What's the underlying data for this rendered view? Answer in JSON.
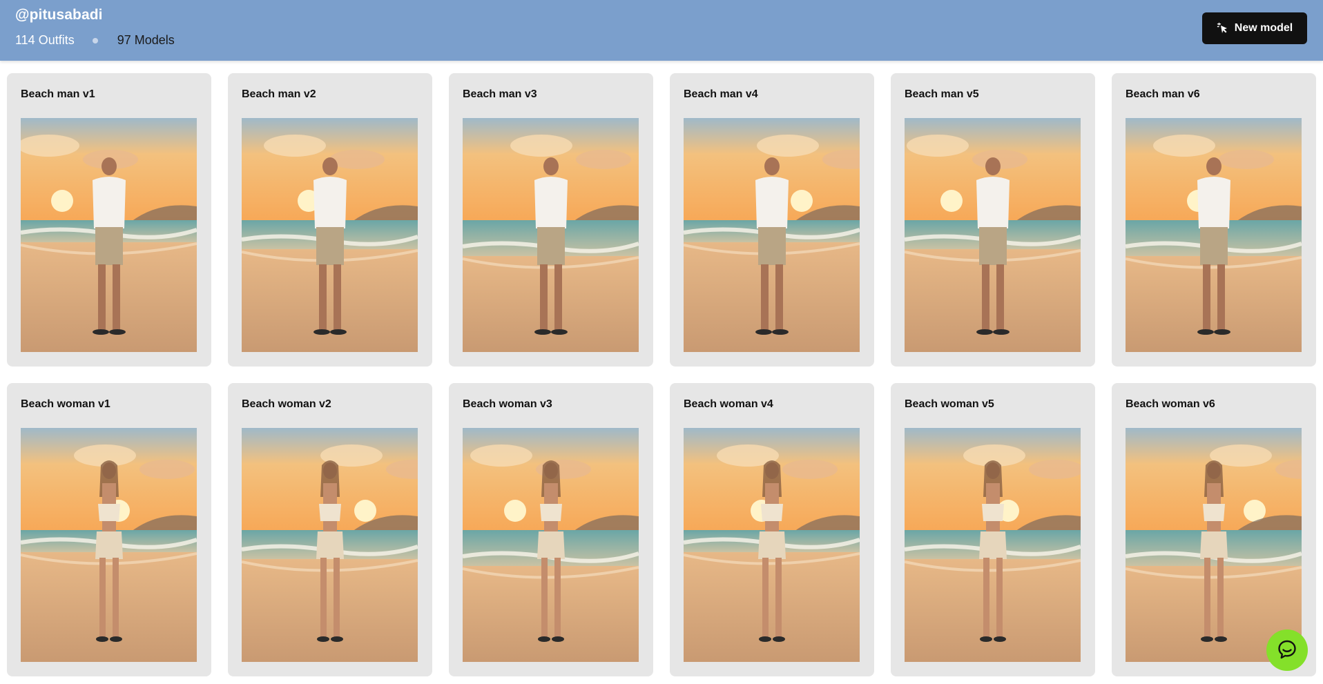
{
  "header": {
    "username": "@pitusabadi",
    "outfits_label": "114 Outfits",
    "models_label": "97 Models",
    "new_model_label": "New model"
  },
  "cards": [
    {
      "title": "Beach man v1",
      "gender": "man"
    },
    {
      "title": "Beach man v2",
      "gender": "man"
    },
    {
      "title": "Beach man v3",
      "gender": "man"
    },
    {
      "title": "Beach man v4",
      "gender": "man"
    },
    {
      "title": "Beach man v5",
      "gender": "man"
    },
    {
      "title": "Beach man v6",
      "gender": "man"
    },
    {
      "title": "Beach woman v1",
      "gender": "woman"
    },
    {
      "title": "Beach woman v2",
      "gender": "woman"
    },
    {
      "title": "Beach woman v3",
      "gender": "woman"
    },
    {
      "title": "Beach woman v4",
      "gender": "woman"
    },
    {
      "title": "Beach woman v5",
      "gender": "woman"
    },
    {
      "title": "Beach woman v6",
      "gender": "woman"
    }
  ],
  "icons": {
    "new_model": "cursor-sparkle-icon",
    "chat": "chat-bubble-icon"
  },
  "colors": {
    "header_bg": "#7b9fcc",
    "button_bg": "#111111",
    "card_bg": "#e6e6e6",
    "chat_bg": "#84e02a"
  }
}
